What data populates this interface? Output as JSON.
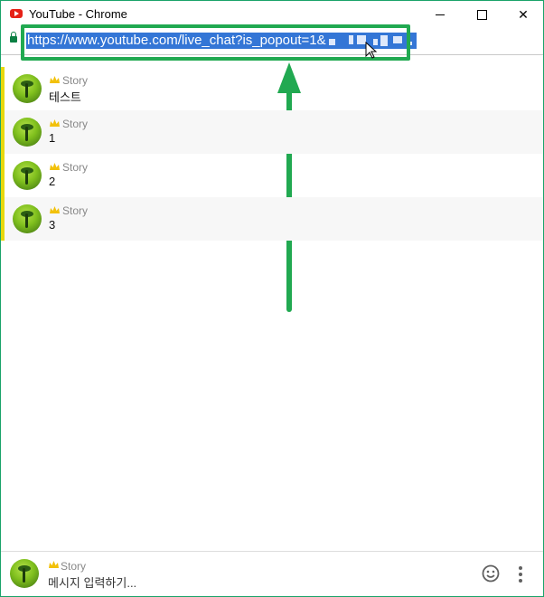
{
  "window": {
    "title": "YouTube - Chrome",
    "controls": {
      "minimize": "minimize",
      "maximize": "maximize",
      "close": "✕"
    }
  },
  "address_bar": {
    "url_visible": "https://www.youtube.com/live_chat?is_popout=1&",
    "url_redacted_suffix": true,
    "secure_icon": "lock-icon"
  },
  "annotation": {
    "color": "#21a951",
    "box_target": "address-bar-url",
    "arrow_direction": "up"
  },
  "chat": {
    "messages": [
      {
        "author": "Story",
        "badge": "crown-icon",
        "text": "테스트"
      },
      {
        "author": "Story",
        "badge": "crown-icon",
        "text": "1"
      },
      {
        "author": "Story",
        "badge": "crown-icon",
        "text": "2"
      },
      {
        "author": "Story",
        "badge": "crown-icon",
        "text": "3"
      }
    ],
    "highlight_color": "#e8d80c"
  },
  "composer": {
    "author": "Story",
    "placeholder": "메시지 입력하기...",
    "emoji_icon": "emoji-icon",
    "more_icon": "more-vertical-icon"
  }
}
